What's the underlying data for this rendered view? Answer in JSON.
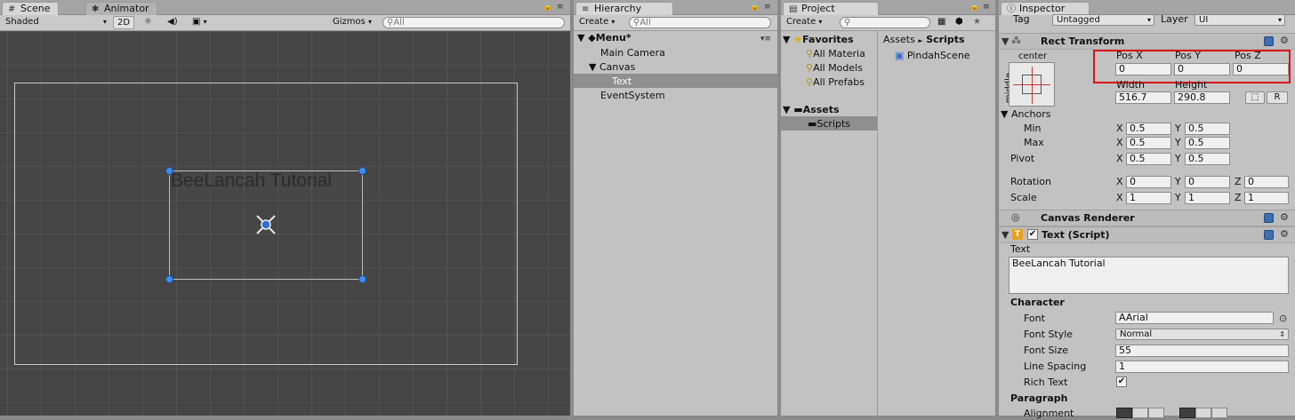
{
  "scene": {
    "tab_scene": "Scene",
    "tab_animator": "Animator",
    "shading": "Shaded",
    "mode_2d": "2D",
    "gizmos": "Gizmos",
    "search_placeholder": "All",
    "canvas_text": "BeeLancah Tutorial"
  },
  "hierarchy": {
    "tab": "Hierarchy",
    "create": "Create",
    "search_placeholder": "All",
    "scene_name": "Menu*",
    "items": [
      "Main Camera",
      "Canvas",
      "Text",
      "EventSystem"
    ]
  },
  "project": {
    "tab": "Project",
    "create": "Create",
    "favorites": "Favorites",
    "fav_items": [
      "All Materia",
      "All Models",
      "All Prefabs"
    ],
    "assets": "Assets",
    "assets_items": [
      "Scripts"
    ],
    "breadcrumb_assets": "Assets",
    "breadcrumb_sep": "►",
    "breadcrumb_scripts": "Scripts",
    "file": "PindahScene"
  },
  "inspector": {
    "tab": "Inspector",
    "tag_label": "Tag",
    "tag_value": "Untagged",
    "layer_label": "Layer",
    "layer_value": "UI",
    "rect_transform": {
      "title": "Rect Transform",
      "anchor_h": "center",
      "anchor_v": "middle",
      "pos_x_label": "Pos X",
      "pos_y_label": "Pos Y",
      "pos_z_label": "Pos Z",
      "pos_x": "0",
      "pos_y": "0",
      "pos_z": "0",
      "width_label": "Width",
      "height_label": "Height",
      "width": "516.7",
      "height": "290.8",
      "r_button": "R",
      "anchors_label": "Anchors",
      "min_label": "Min",
      "max_label": "Max",
      "pivot_label": "Pivot",
      "rotation_label": "Rotation",
      "scale_label": "Scale",
      "x": "X",
      "y": "Y",
      "z": "Z",
      "min_x": "0.5",
      "min_y": "0.5",
      "max_x": "0.5",
      "max_y": "0.5",
      "pivot_x": "0.5",
      "pivot_y": "0.5",
      "rot_x": "0",
      "rot_y": "0",
      "rot_z": "0",
      "scale_x": "1",
      "scale_y": "1",
      "scale_z": "1"
    },
    "canvas_renderer": {
      "title": "Canvas Renderer"
    },
    "text_script": {
      "title": "Text (Script)",
      "text_label": "Text",
      "text_value": "BeeLancah Tutorial",
      "character_label": "Character",
      "font_label": "Font",
      "font_value": "Arial",
      "font_style_label": "Font Style",
      "font_style_value": "Normal",
      "font_size_label": "Font Size",
      "font_size_value": "55",
      "line_spacing_label": "Line Spacing",
      "line_spacing_value": "1",
      "rich_text_label": "Rich Text",
      "paragraph_label": "Paragraph",
      "alignment_label": "Alignment"
    }
  },
  "colors": {
    "highlight_red": "#e0121a",
    "handle_blue": "#3d8df0",
    "scene_bg": "#464646"
  }
}
